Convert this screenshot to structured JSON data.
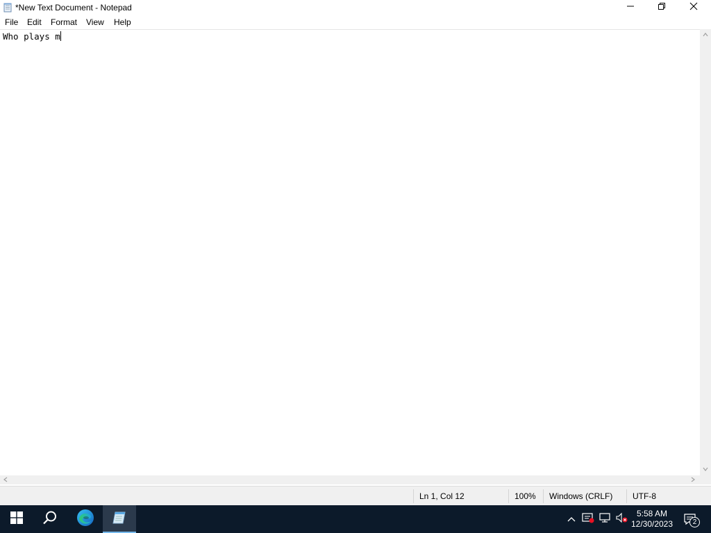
{
  "window": {
    "title": "*New Text Document - Notepad",
    "controls": {
      "minimize": "minimize-icon",
      "restore": "restore-icon",
      "close": "close-icon"
    }
  },
  "menu": {
    "items": [
      {
        "label": "File"
      },
      {
        "label": "Edit"
      },
      {
        "label": "Format"
      },
      {
        "label": "View"
      },
      {
        "label": "Help"
      }
    ]
  },
  "editor": {
    "content": "Who plays m"
  },
  "status": {
    "position": "Ln 1, Col 12",
    "zoom": "100%",
    "line_ending": "Windows (CRLF)",
    "encoding": "UTF-8"
  },
  "taskbar": {
    "items": [
      "start-icon",
      "search-icon",
      "edge-icon",
      "notepad-icon"
    ],
    "clock": {
      "time": "5:58 AM",
      "date": "12/30/2023"
    },
    "notifications_count": "2"
  },
  "colors": {
    "taskbar_bg": "#0c1a2a",
    "accent": "#76b9ed"
  }
}
